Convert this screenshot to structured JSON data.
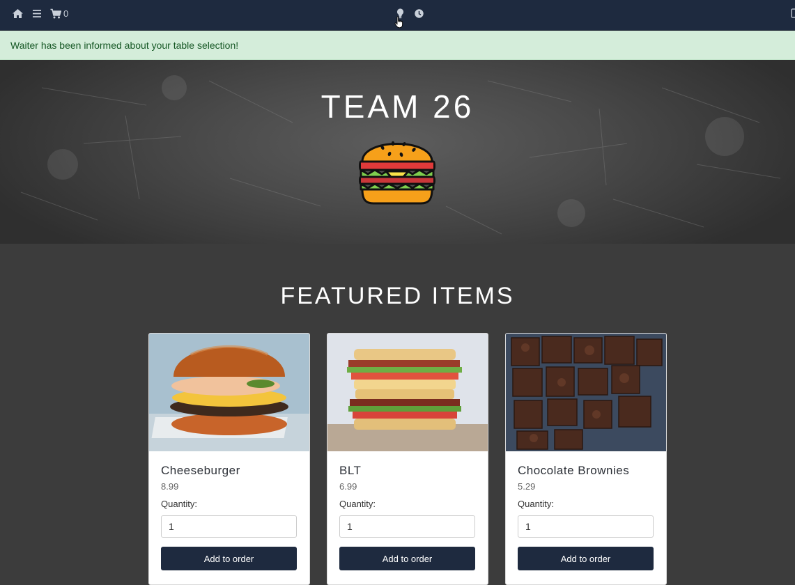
{
  "nav": {
    "cart_count": "0",
    "icons": [
      "home-icon",
      "menu-icon",
      "cart-icon",
      "waiter-call-icon",
      "clock-icon"
    ]
  },
  "alert": {
    "message": "Waiter has been informed about your table selection!"
  },
  "hero": {
    "title": "TEAM 26"
  },
  "featured": {
    "title": "FEATURED ITEMS",
    "items": [
      {
        "name": "Cheeseburger",
        "price": "8.99",
        "quantity_label": "Quantity:",
        "quantity": "1",
        "button": "Add to order"
      },
      {
        "name": "BLT",
        "price": "6.99",
        "quantity_label": "Quantity:",
        "quantity": "1",
        "button": "Add to order"
      },
      {
        "name": "Chocolate Brownies",
        "price": "5.29",
        "quantity_label": "Quantity:",
        "quantity": "1",
        "button": "Add to order"
      }
    ]
  },
  "colors": {
    "navbar": "#1e2a3f",
    "alert_bg": "#d4edda",
    "alert_text": "#155724",
    "page_bg": "#3c3c3c",
    "button": "#1e2a3f"
  }
}
